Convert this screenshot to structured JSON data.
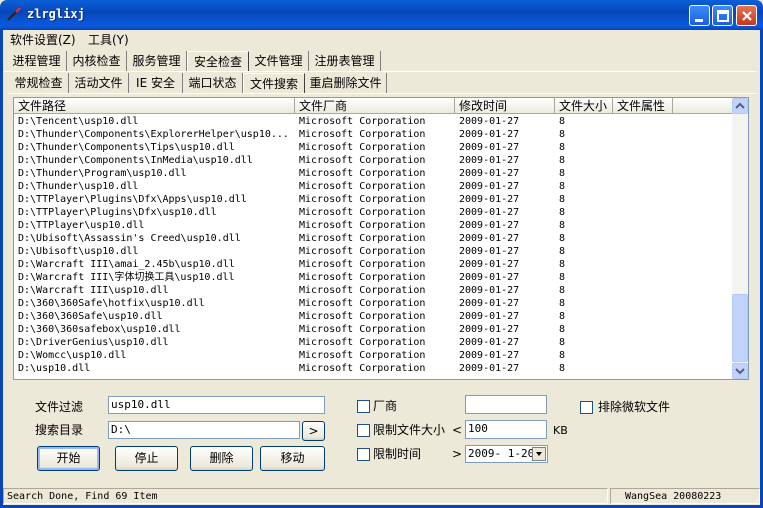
{
  "window": {
    "title": "zlrglixj"
  },
  "menu": [
    "软件设置(Z)",
    "工具(Y)"
  ],
  "main_tabs": [
    "进程管理",
    "内核检查",
    "服务管理",
    "安全检查",
    "文件管理",
    "注册表管理"
  ],
  "sub_tabs": [
    "常规检查",
    "活动文件",
    "IE 安全",
    "端口状态",
    "文件搜索",
    "重启删除文件"
  ],
  "table": {
    "columns": [
      "文件路径",
      "文件厂商",
      "修改时间",
      "文件大小",
      "文件属性"
    ],
    "rows": [
      [
        "D:\\Tencent\\usp10.dll",
        "Microsoft Corporation",
        "2009-01-27",
        "8",
        ""
      ],
      [
        "D:\\Thunder\\Components\\ExplorerHelper\\usp10...",
        "Microsoft Corporation",
        "2009-01-27",
        "8",
        ""
      ],
      [
        "D:\\Thunder\\Components\\Tips\\usp10.dll",
        "Microsoft Corporation",
        "2009-01-27",
        "8",
        ""
      ],
      [
        "D:\\Thunder\\Components\\InMedia\\usp10.dll",
        "Microsoft Corporation",
        "2009-01-27",
        "8",
        ""
      ],
      [
        "D:\\Thunder\\Program\\usp10.dll",
        "Microsoft Corporation",
        "2009-01-27",
        "8",
        ""
      ],
      [
        "D:\\Thunder\\usp10.dll",
        "Microsoft Corporation",
        "2009-01-27",
        "8",
        ""
      ],
      [
        "D:\\TTPlayer\\Plugins\\Dfx\\Apps\\usp10.dll",
        "Microsoft Corporation",
        "2009-01-27",
        "8",
        ""
      ],
      [
        "D:\\TTPlayer\\Plugins\\Dfx\\usp10.dll",
        "Microsoft Corporation",
        "2009-01-27",
        "8",
        ""
      ],
      [
        "D:\\TTPlayer\\usp10.dll",
        "Microsoft Corporation",
        "2009-01-27",
        "8",
        ""
      ],
      [
        "D:\\Ubisoft\\Assassin's Creed\\usp10.dll",
        "Microsoft Corporation",
        "2009-01-27",
        "8",
        ""
      ],
      [
        "D:\\Ubisoft\\usp10.dll",
        "Microsoft Corporation",
        "2009-01-27",
        "8",
        ""
      ],
      [
        "D:\\Warcraft III\\amai_2.45b\\usp10.dll",
        "Microsoft Corporation",
        "2009-01-27",
        "8",
        ""
      ],
      [
        "D:\\Warcraft III\\字体切换工具\\usp10.dll",
        "Microsoft Corporation",
        "2009-01-27",
        "8",
        ""
      ],
      [
        "D:\\Warcraft III\\usp10.dll",
        "Microsoft Corporation",
        "2009-01-27",
        "8",
        ""
      ],
      [
        "D:\\360\\360Safe\\hotfix\\usp10.dll",
        "Microsoft Corporation",
        "2009-01-27",
        "8",
        ""
      ],
      [
        "D:\\360\\360Safe\\usp10.dll",
        "Microsoft Corporation",
        "2009-01-27",
        "8",
        ""
      ],
      [
        "D:\\360\\360safebox\\usp10.dll",
        "Microsoft Corporation",
        "2009-01-27",
        "8",
        ""
      ],
      [
        "D:\\DriverGenius\\usp10.dll",
        "Microsoft Corporation",
        "2009-01-27",
        "8",
        ""
      ],
      [
        "D:\\Womcc\\usp10.dll",
        "Microsoft Corporation",
        "2009-01-27",
        "8",
        ""
      ],
      [
        "D:\\usp10.dll",
        "Microsoft Corporation",
        "2009-01-27",
        "8",
        ""
      ]
    ]
  },
  "form": {
    "filter_label": "文件过滤",
    "filter_value": "usp10.dll",
    "dir_label": "搜索目录",
    "dir_value": "D:\\",
    "browse_label": ">",
    "vendor_label": "厂商",
    "vendor_value": "",
    "exclude_label": "排除微软文件",
    "size_label": "限制文件大小",
    "size_op": "<",
    "size_value": "100",
    "size_unit": "KB",
    "time_label": "限制时间",
    "time_op": ">",
    "time_value": "2009- 1-20"
  },
  "buttons": {
    "start": "开始",
    "stop": "停止",
    "delete": "删除",
    "move": "移动"
  },
  "status": {
    "left": "Search Done, Find 69 Item",
    "right": "WangSea 20080223"
  },
  "colors": {
    "titlebar": "#0846b8",
    "face": "#ece9d8",
    "close": "#c4381b"
  }
}
